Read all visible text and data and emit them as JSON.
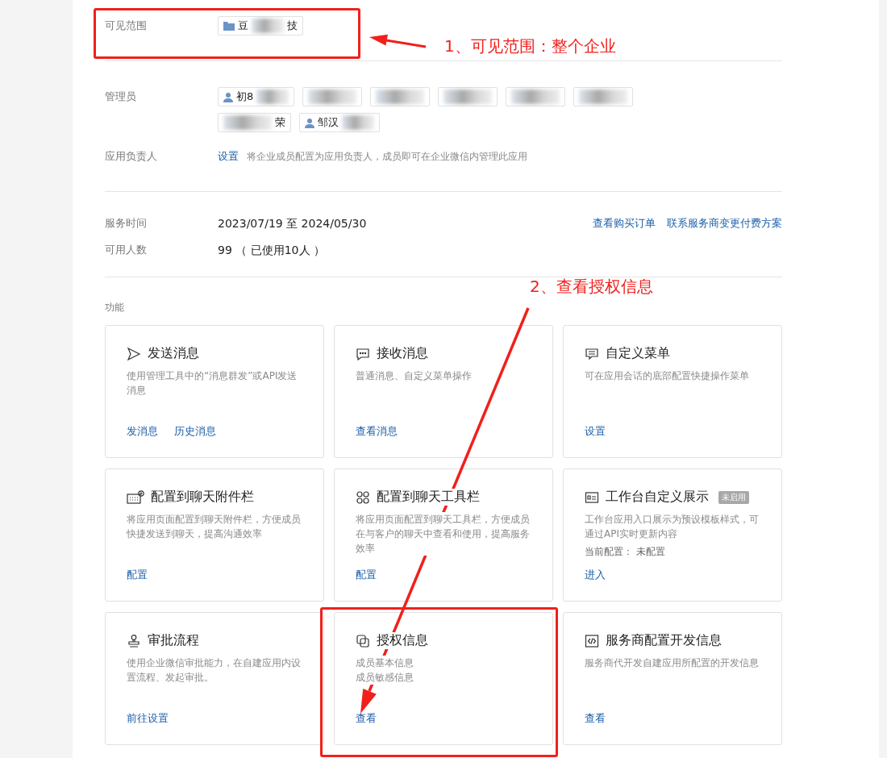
{
  "visible_range": {
    "label": "可见范围",
    "chips": [
      {
        "kind": "department",
        "start": "豆",
        "end": "技"
      }
    ]
  },
  "admins": {
    "label": "管理员",
    "chips": [
      {
        "kind": "person",
        "start": "初8"
      },
      {
        "kind": "blurred"
      },
      {
        "kind": "blurred"
      },
      {
        "kind": "blurred"
      },
      {
        "kind": "blurred"
      },
      {
        "kind": "blurred"
      },
      {
        "kind": "blurred",
        "end": "荣"
      },
      {
        "kind": "person",
        "start": "邹汉"
      }
    ]
  },
  "owner": {
    "label": "应用负责人",
    "link": "设置",
    "hint": "将企业成员配置为应用负责人，成员即可在企业微信内管理此应用"
  },
  "service": {
    "label": "服务时间",
    "value": "2023/07/19 至 2024/05/30",
    "links": [
      "查看购买订单",
      "联系服务商变更付费方案"
    ]
  },
  "seats": {
    "label": "可用人数",
    "value": "99 （ 已使用10人 ）"
  },
  "features": {
    "label": "功能",
    "cards": [
      {
        "kind": "send",
        "title": "发送消息",
        "description": [
          "使用管理工具中的“消息群发”或API发送消息"
        ],
        "actions": [
          "发消息",
          "历史消息"
        ]
      },
      {
        "kind": "chat",
        "title": "接收消息",
        "description": [
          "普通消息、自定义菜单操作"
        ],
        "actions": [
          "查看消息"
        ]
      },
      {
        "kind": "menu",
        "title": "自定义菜单",
        "description": [
          "可在应用会话的底部配置快捷操作菜单"
        ],
        "actions": [
          "设置"
        ]
      },
      {
        "kind": "attach",
        "title": "配置到聊天附件栏",
        "description": [
          "将应用页面配置到聊天附件栏，方便成员快捷发送到聊天，提高沟通效率"
        ],
        "actions": [
          "配置"
        ]
      },
      {
        "kind": "tools",
        "title": "配置到聊天工具栏",
        "description": [
          "将应用页面配置到聊天工具栏，方便成员在与客户的聊天中查看和使用，提高服务效率"
        ],
        "actions": [
          "配置"
        ]
      },
      {
        "kind": "card",
        "title": "工作台自定义展示",
        "badge": "未启用",
        "description": [
          "工作台应用入口展示为预设模板样式，可通过API实时更新内容"
        ],
        "note": "当前配置： 未配置",
        "actions": [
          "进入"
        ]
      },
      {
        "kind": "stamp",
        "title": "审批流程",
        "description": [
          "使用企业微信审批能力，在自建应用内设置流程、发起审批。"
        ],
        "actions": [
          "前往设置"
        ]
      },
      {
        "kind": "copy",
        "title": "授权信息",
        "description": [
          "成员基本信息",
          "成员敏感信息"
        ],
        "actions": [
          "查看"
        ]
      },
      {
        "kind": "code",
        "title": "服务商配置开发信息",
        "description": [
          "服务商代开发自建应用所配置的开发信息"
        ],
        "actions": [
          "查看"
        ]
      }
    ]
  },
  "annotations": [
    "1、可见范围：整个企业",
    "2、查看授权信息"
  ]
}
